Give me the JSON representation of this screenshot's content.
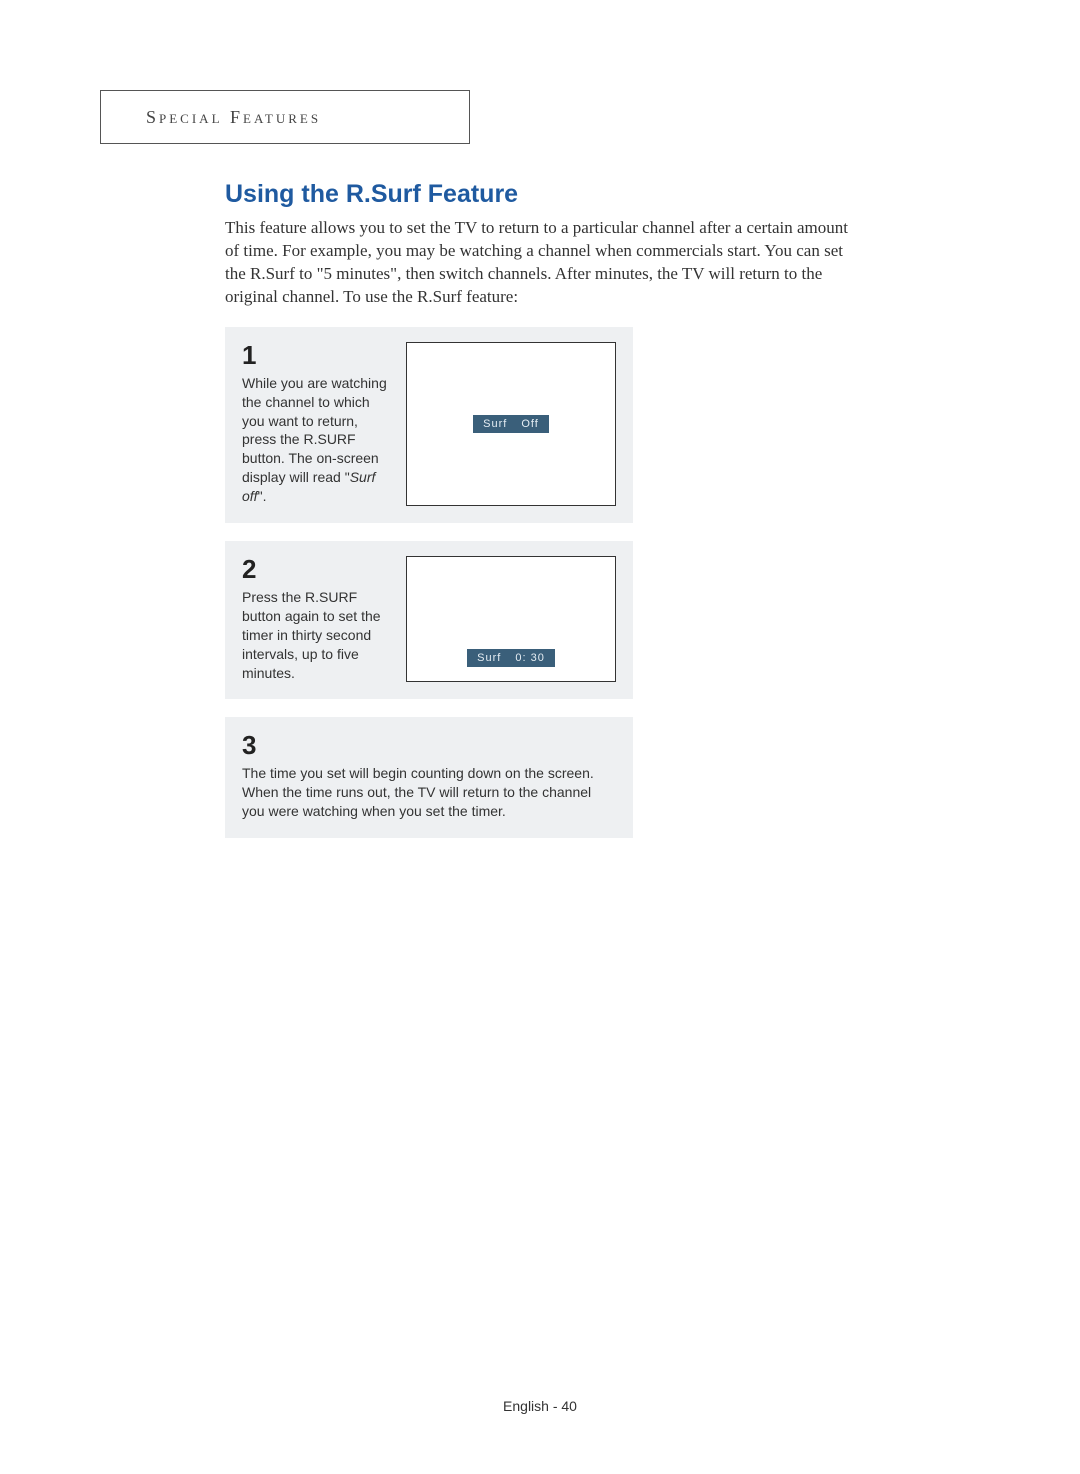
{
  "section_header": "Special Features",
  "title": "Using the R.Surf Feature",
  "intro": "This feature allows you to set the TV to return to a particular channel after a certain amount of time. For example, you may be watching a channel when commercials start. You can set the R.Surf to \"5 minutes\", then switch channels. After minutes, the TV will return to the original channel. To use the R.Surf feature:",
  "steps": {
    "s1": {
      "num": "1",
      "text_pre": "While you are watching the channel to which you want to return, press the R.SURF button. The on-screen display will read ",
      "quoted": "Surf off",
      "text_post": ".",
      "osd_label": "Surf",
      "osd_value": "Off"
    },
    "s2": {
      "num": "2",
      "text": "Press the R.SURF button again to set the timer in thirty second intervals, up to five minutes.",
      "osd_label": "Surf",
      "osd_value": "0:  30"
    },
    "s3": {
      "num": "3",
      "text": "The time you set will begin counting down on the screen. When the time runs out, the TV will return to the channel you were watching when you set the timer."
    }
  },
  "footer": "English - 40"
}
